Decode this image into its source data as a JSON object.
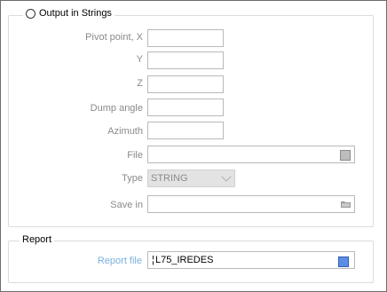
{
  "strings_group": {
    "option_label": "Output in Strings",
    "pivot_x_label": "Pivot point, X",
    "y_label": "Y",
    "z_label": "Z",
    "dump_angle_label": "Dump angle",
    "azimuth_label": "Azimuth",
    "file_label": "File",
    "type_label": "Type",
    "type_value": "STRING",
    "save_in_label": "Save in"
  },
  "report_group": {
    "title": "Report",
    "report_file_label": "Report file",
    "report_file_value": "L75_IREDES",
    "caret_glyph": "¦"
  },
  "colors": {
    "disabled_label": "#8a8a8a",
    "report_label": "#7ab0dc",
    "picker_blue": "#5b8de6"
  }
}
